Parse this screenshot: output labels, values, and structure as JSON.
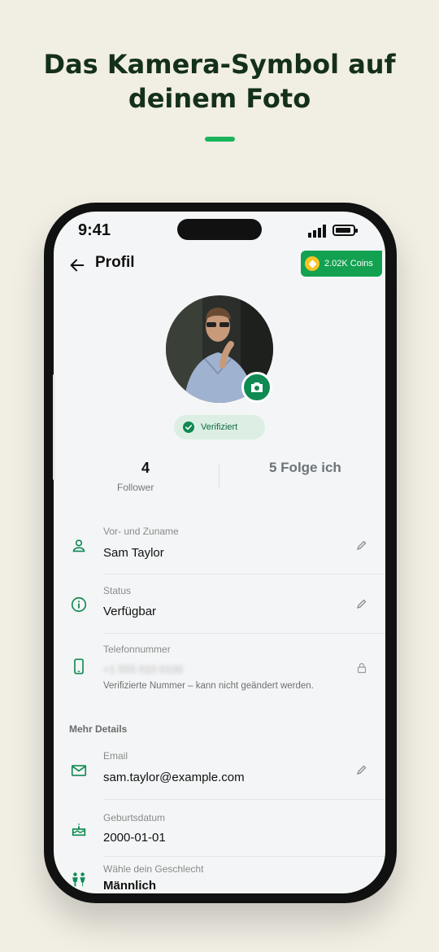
{
  "headline": {
    "line1": "Das Kamera-Symbol auf",
    "line2": "deinem Foto"
  },
  "status_bar": {
    "time": "9:41"
  },
  "header": {
    "title": "Profil",
    "coins_label": "2.02K Coins"
  },
  "profile": {
    "verified_label": "Verifiziert"
  },
  "stats": {
    "followers_count": "4",
    "followers_label": "Follower",
    "following_label": "5 Folge ich"
  },
  "fields": {
    "name": {
      "label": "Vor- und Zuname",
      "value": "Sam Taylor"
    },
    "status": {
      "label": "Status",
      "value": "Verfügbar"
    },
    "phone": {
      "label": "Telefonnummer",
      "value": "+1 555 010 0100",
      "hint": "Verifizierte Nummer – kann nicht geändert werden."
    }
  },
  "more_details": {
    "title": "Mehr Details",
    "email": {
      "label": "Email",
      "value": "sam.taylor@example.com"
    },
    "birthday": {
      "label": "Geburtsdatum",
      "value": "2000-01-01"
    },
    "gender": {
      "label": "Wähle dein Geschlecht",
      "value": "Männlich"
    }
  },
  "colors": {
    "background": "#f1eee4",
    "accent": "#19b45a",
    "primary_green": "#0f8a52",
    "coins_green": "#12a150"
  }
}
